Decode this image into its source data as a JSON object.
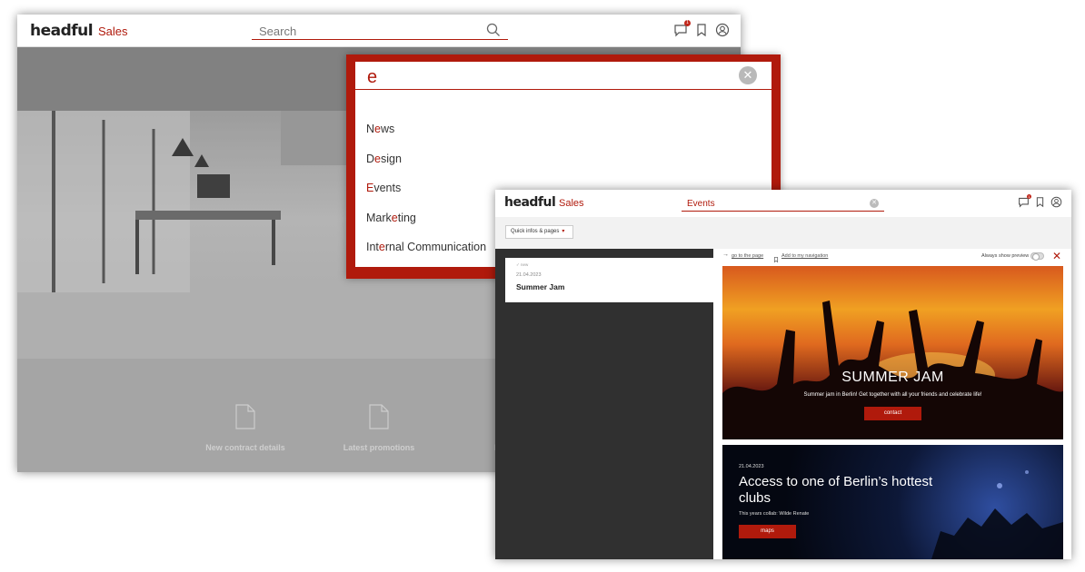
{
  "brand": {
    "logo": "headful",
    "app": "Sales",
    "accent": "#b01a0c"
  },
  "back_window": {
    "search_placeholder": "Search",
    "notifications_count": "1",
    "links": [
      {
        "label": "New contract details"
      },
      {
        "label": "Latest promotions"
      },
      {
        "label": "Most l"
      }
    ]
  },
  "dropdown": {
    "query": "e",
    "suggestions": [
      {
        "before": "N",
        "match": "e",
        "after": "ws"
      },
      {
        "before": "D",
        "match": "e",
        "after": "sign"
      },
      {
        "before": "",
        "match": "E",
        "after": "vents"
      },
      {
        "before": "Mark",
        "match": "e",
        "after": "ting"
      },
      {
        "before": "Int",
        "match": "e",
        "after": "rnal Communication"
      }
    ]
  },
  "front_window": {
    "search_value": "Events",
    "notifications_count": "1",
    "quick_button": "Quick infos & pages",
    "result": {
      "meta": "✓ new",
      "date": "21.04.2023",
      "title": "Summer Jam"
    },
    "preview": {
      "go_to_page": "go to the page",
      "add_to_nav": "Add to my navigation",
      "always_show": "Always show preview"
    },
    "card_a": {
      "title": "SUMMER JAM",
      "subtitle": "Summer jam in Berlin! Get together with all your friends and celebrate life!",
      "button": "contact"
    },
    "card_b": {
      "date": "21.04.2023",
      "title": "Access to one of Berlin’s hottest clubs",
      "subtitle": "This years collab: Wilde Renate",
      "button": "maps"
    }
  }
}
